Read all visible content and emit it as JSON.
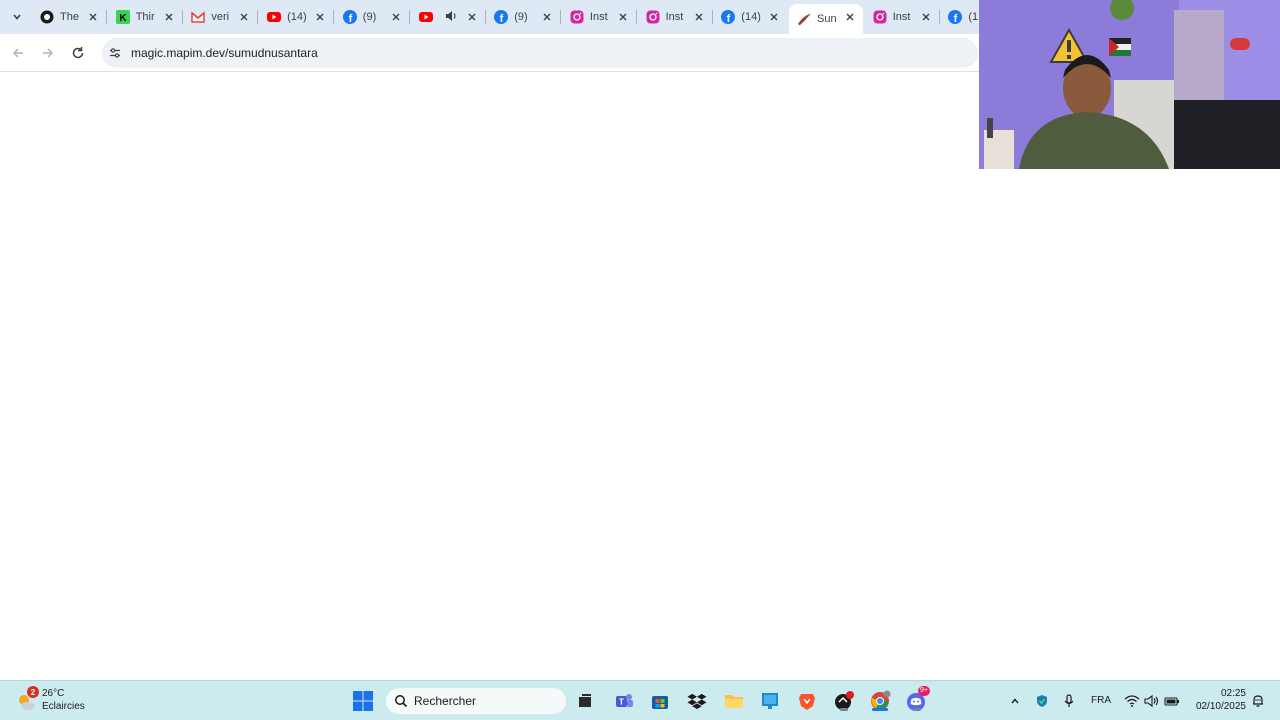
{
  "browser": {
    "tabs": [
      {
        "title": "The",
        "icon": "github-icon",
        "color": "#1a1a1a"
      },
      {
        "title": "Thir",
        "icon": "k-icon",
        "color": "#39d353"
      },
      {
        "title": "veri",
        "icon": "gmail-icon",
        "color": "#ea4335"
      },
      {
        "title": "(14)",
        "icon": "youtube-icon",
        "color": "#ff0000"
      },
      {
        "title": "(9)",
        "icon": "facebook-icon",
        "color": "#1877f2"
      },
      {
        "title": "",
        "icon": "youtube-icon",
        "color": "#ff0000",
        "audio": true
      },
      {
        "title": "(9)",
        "icon": "facebook-icon",
        "color": "#1877f2"
      },
      {
        "title": "Inst",
        "icon": "instagram-icon",
        "color": "#d6249f"
      },
      {
        "title": "Inst",
        "icon": "instagram-icon",
        "color": "#d6249f"
      },
      {
        "title": "(14)",
        "icon": "facebook-icon",
        "color": "#1877f2"
      },
      {
        "title": "Sun",
        "icon": "brush-icon",
        "color": "#c62828",
        "active": true
      },
      {
        "title": "Inst",
        "icon": "instagram-icon",
        "color": "#d6249f"
      },
      {
        "title": "(1",
        "icon": "facebook-icon",
        "color": "#1877f2"
      }
    ],
    "url": "magic.mapim.dev/sumudnusantara"
  },
  "taskbar": {
    "weather": {
      "badge": "2",
      "temp": "26°C",
      "condition": "Eclaircies"
    },
    "search_label": "Rechercher",
    "language": "FRA",
    "time": "02:25",
    "date": "02/10/2025",
    "discord_badge": "9+"
  }
}
